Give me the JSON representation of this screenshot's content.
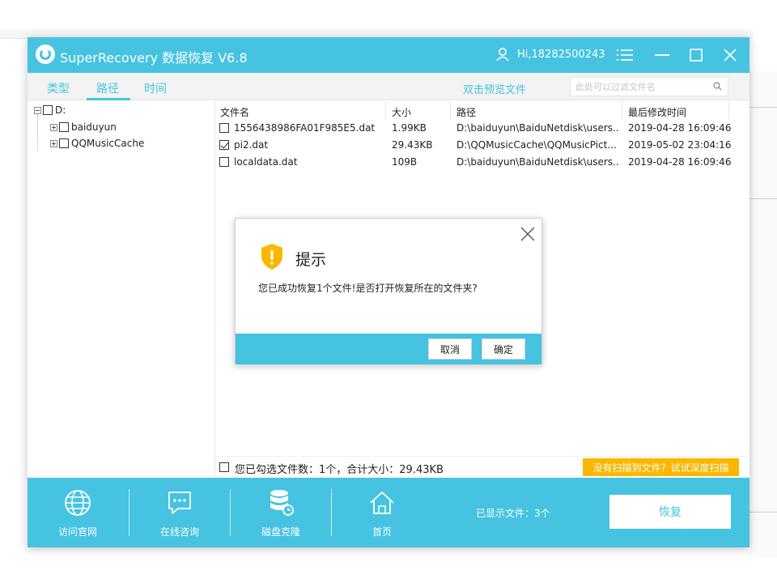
{
  "app": {
    "title": "SuperRecovery 数据恢复 V6.8",
    "user": "Hi,18282500243"
  },
  "tabs": [
    {
      "label": "类型",
      "active": false
    },
    {
      "label": "路径",
      "active": true
    },
    {
      "label": "时间",
      "active": false
    }
  ],
  "preview_hint": "双击预览文件",
  "search": {
    "placeholder": "此处可以过滤文件名"
  },
  "tree": {
    "root": "D:",
    "children": [
      "baiduyun",
      "QQMusicCache"
    ]
  },
  "table": {
    "headers": [
      "文件名",
      "大小",
      "路径",
      "最后修改时间"
    ],
    "rows": [
      {
        "name": "1556438986FA01F985E5.dat",
        "size": "1.99KB",
        "path": "D:\\baiduyun\\BaiduNetdisk\\users...",
        "modified": "2019-04-28 16:09:46",
        "checked": false
      },
      {
        "name": "pi2.dat",
        "size": "29.43KB",
        "path": "D:\\QQMusicCache\\QQMusicPict...",
        "modified": "2019-05-02 23:04:16",
        "checked": true
      },
      {
        "name": "localdata.dat",
        "size": "109B",
        "path": "D:\\baiduyun\\BaiduNetdisk\\users...",
        "modified": "2019-04-28 16:09:46",
        "checked": false
      }
    ]
  },
  "selection": {
    "summary": "您已勾选文件数：1个，合计大小：29.43KB",
    "deep_scan": "没有扫描到文件？试试深度扫描"
  },
  "footer": {
    "items": [
      {
        "label": "访问官网",
        "icon": "globe-icon"
      },
      {
        "label": "在线咨询",
        "icon": "chat-icon"
      },
      {
        "label": "磁盘克隆",
        "icon": "database-icon"
      },
      {
        "label": "首页",
        "icon": "home-icon"
      }
    ],
    "shown_count": "已显示文件：3个",
    "recover": "恢复"
  },
  "dialog": {
    "title": "提示",
    "message": "您已成功恢复1个文件!是否打开恢复所在的文件夹?",
    "cancel": "取消",
    "ok": "确定"
  },
  "colors": {
    "accent": "#45c3e1",
    "warning": "#fbb700"
  }
}
